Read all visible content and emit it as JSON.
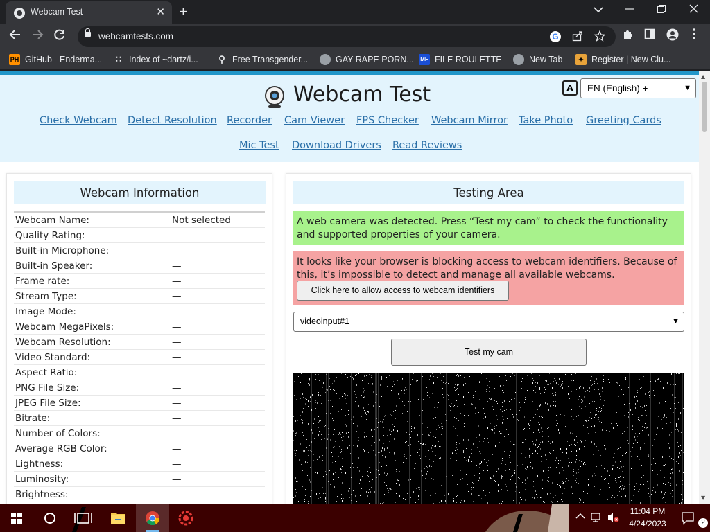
{
  "browser": {
    "tab_title": "Webcam Test",
    "tab_close": "✕",
    "new_tab": "+",
    "url": "webcamtests.com",
    "bookmarks": [
      {
        "icon": "PH",
        "label": "GitHub - Enderma..."
      },
      {
        "icon": "folder",
        "label": "Index of ~dartz/i..."
      },
      {
        "icon": "trans",
        "label": "Free Transgender..."
      },
      {
        "icon": "globe",
        "label": "GAY RAPE PORN..."
      },
      {
        "icon": "MF",
        "label": "FILE ROULETTE"
      },
      {
        "icon": "globe",
        "label": "New Tab"
      },
      {
        "icon": "register",
        "label": "Register | New Clu..."
      }
    ]
  },
  "site": {
    "title": "Webcam Test",
    "language": "EN (English) +",
    "nav_row1": [
      "Check Webcam",
      "Detect Resolution",
      "Recorder",
      "Cam Viewer",
      "FPS Checker",
      "Webcam Mirror",
      "Take Photo",
      "Greeting Cards"
    ],
    "nav_row2": [
      "Mic Test",
      "Download Drivers",
      "Read Reviews"
    ]
  },
  "info_panel": {
    "heading": "Webcam Information",
    "rows": [
      {
        "label": "Webcam Name:",
        "value": "Not selected"
      },
      {
        "label": "Quality Rating:",
        "value": "—"
      },
      {
        "label": "Built-in Microphone:",
        "value": "—"
      },
      {
        "label": "Built-in Speaker:",
        "value": "—"
      },
      {
        "label": "Frame rate:",
        "value": "—"
      },
      {
        "label": "Stream Type:",
        "value": "—"
      },
      {
        "label": "Image Mode:",
        "value": "—"
      },
      {
        "label": "Webcam MegaPixels:",
        "value": "—"
      },
      {
        "label": "Webcam Resolution:",
        "value": "—"
      },
      {
        "label": "Video Standard:",
        "value": "—"
      },
      {
        "label": "Aspect Ratio:",
        "value": "—"
      },
      {
        "label": "PNG File Size:",
        "value": "—"
      },
      {
        "label": "JPEG File Size:",
        "value": "—"
      },
      {
        "label": "Bitrate:",
        "value": "—"
      },
      {
        "label": "Number of Colors:",
        "value": "—"
      },
      {
        "label": "Average RGB Color:",
        "value": "—"
      },
      {
        "label": "Lightness:",
        "value": "—"
      },
      {
        "label": "Luminosity:",
        "value": "—"
      },
      {
        "label": "Brightness:",
        "value": "—"
      }
    ]
  },
  "testing_area": {
    "heading": "Testing Area",
    "detected_message": "A web camera was detected. Press “Test my cam” to check the functionality and supported properties of your camera.",
    "blocked_message": "It looks like your browser is blocking access to webcam identifiers. Because of this, it’s impossible to detect and manage all available webcams.",
    "allow_button": "Click here to allow access to webcam identifiers",
    "device_selected": "videoinput#1",
    "test_button": "Test my cam"
  },
  "taskbar": {
    "time": "11:04 PM",
    "date": "4/24/2023",
    "notification_count": "2"
  },
  "colors": {
    "accent_blue": "#2196c9",
    "hero_background": "#e3f4fd",
    "link": "#2a6fa8",
    "success_background": "#a8f28c",
    "error_background": "#f5a3a3",
    "taskbar": "#3b0000"
  }
}
